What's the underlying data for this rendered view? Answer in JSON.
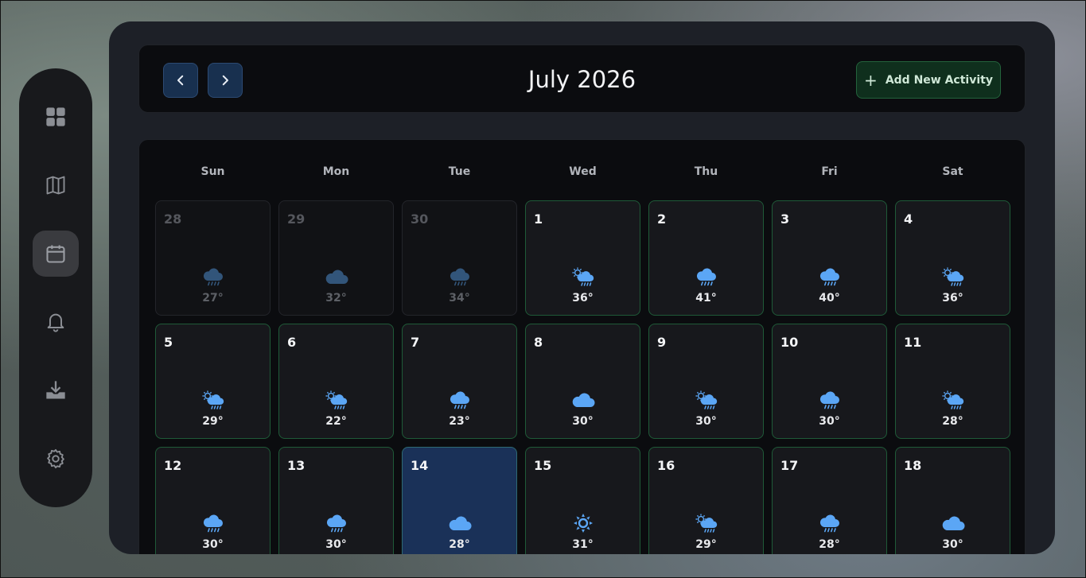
{
  "sidebar": {
    "items": [
      {
        "icon": "dashboard-icon",
        "active": false
      },
      {
        "icon": "map-icon",
        "active": false
      },
      {
        "icon": "calendar-icon",
        "active": true
      },
      {
        "icon": "bell-icon",
        "active": false
      },
      {
        "icon": "download-icon",
        "active": false
      },
      {
        "icon": "gear-icon",
        "active": false
      }
    ]
  },
  "header": {
    "title": "July 2026",
    "add_label": "Add New Activity"
  },
  "calendar": {
    "weekdays": [
      "Sun",
      "Mon",
      "Tue",
      "Wed",
      "Thu",
      "Fri",
      "Sat"
    ],
    "days": [
      {
        "num": "28",
        "temp": "27°",
        "weather": "rain",
        "other": true
      },
      {
        "num": "29",
        "temp": "32°",
        "weather": "cloud",
        "other": true
      },
      {
        "num": "30",
        "temp": "34°",
        "weather": "rain",
        "other": true
      },
      {
        "num": "1",
        "temp": "36°",
        "weather": "sun-rain"
      },
      {
        "num": "2",
        "temp": "41°",
        "weather": "rain"
      },
      {
        "num": "3",
        "temp": "40°",
        "weather": "rain"
      },
      {
        "num": "4",
        "temp": "36°",
        "weather": "sun-rain"
      },
      {
        "num": "5",
        "temp": "29°",
        "weather": "sun-rain"
      },
      {
        "num": "6",
        "temp": "22°",
        "weather": "sun-rain"
      },
      {
        "num": "7",
        "temp": "23°",
        "weather": "rain"
      },
      {
        "num": "8",
        "temp": "30°",
        "weather": "cloud"
      },
      {
        "num": "9",
        "temp": "30°",
        "weather": "sun-rain"
      },
      {
        "num": "10",
        "temp": "30°",
        "weather": "rain"
      },
      {
        "num": "11",
        "temp": "28°",
        "weather": "sun-rain"
      },
      {
        "num": "12",
        "temp": "30°",
        "weather": "rain"
      },
      {
        "num": "13",
        "temp": "30°",
        "weather": "rain"
      },
      {
        "num": "14",
        "temp": "28°",
        "weather": "cloud",
        "today": true
      },
      {
        "num": "15",
        "temp": "31°",
        "weather": "sun"
      },
      {
        "num": "16",
        "temp": "29°",
        "weather": "sun-rain"
      },
      {
        "num": "17",
        "temp": "28°",
        "weather": "rain"
      },
      {
        "num": "18",
        "temp": "30°",
        "weather": "cloud"
      }
    ]
  },
  "colors": {
    "accent_green": "#23633c",
    "weather_blue": "#5ba6f5",
    "today_bg": "#1a3158"
  }
}
